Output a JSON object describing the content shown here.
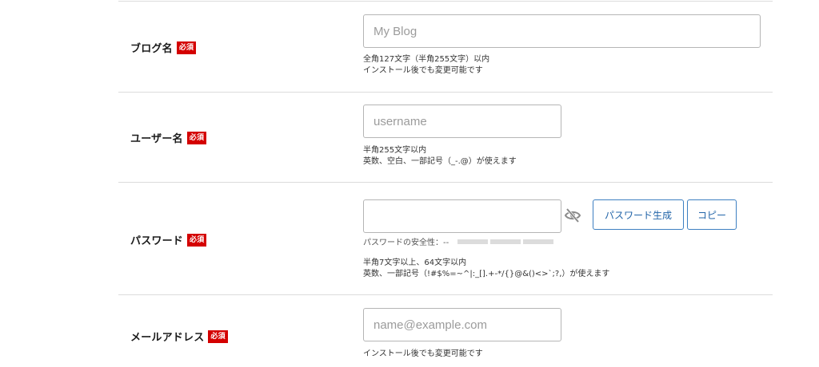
{
  "required_badge": "必須",
  "rows": [
    {
      "label": "ブログ名",
      "placeholder": "My Blog",
      "help": [
        "全角127文字（半角255文字）以内",
        "インストール後でも変更可能です"
      ]
    },
    {
      "label": "ユーザー名",
      "placeholder": "username",
      "help": [
        "半角255文字以内",
        "英数、空白、一部記号（_-.@）が使えます"
      ]
    },
    {
      "label": "パスワード",
      "placeholder": "",
      "strength_label": "パスワードの安全性：--",
      "strength_level": 0,
      "generate_button": "パスワード生成",
      "copy_button": "コピー",
      "help": [
        "半角7文字以上、64文字以内",
        "英数、一部記号（!#$%=~^|:_[].+-*/{}@&()<>`;?,）が使えます"
      ]
    },
    {
      "label": "メールアドレス",
      "placeholder": "name@example.com",
      "help": [
        "インストール後でも変更可能です"
      ]
    }
  ],
  "icons": {
    "visibility_toggle": "eye-slash-icon"
  },
  "colors": {
    "badge": "#d40000",
    "button_text": "#2164a8",
    "button_border": "#3d7fc1"
  }
}
